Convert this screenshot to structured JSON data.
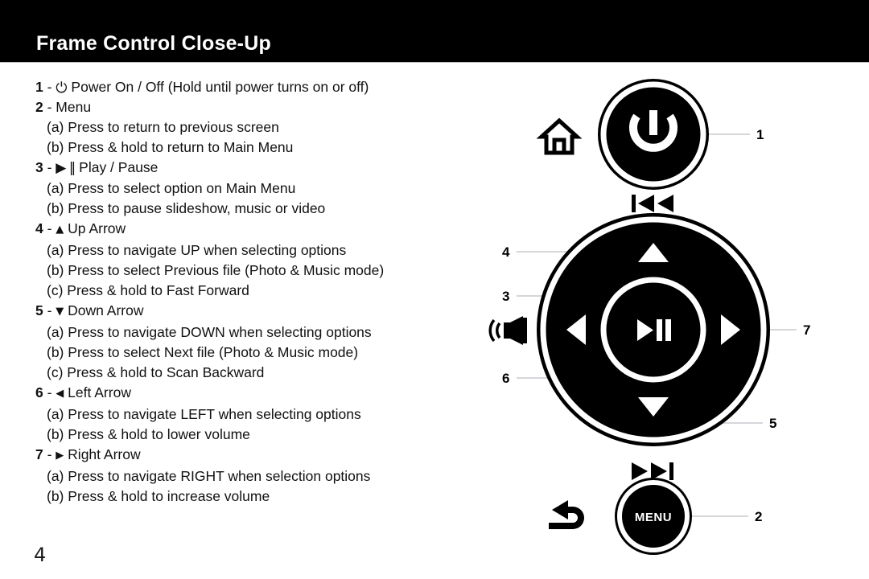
{
  "header": {
    "title": "Frame Control Close-Up"
  },
  "page_number": "4",
  "instructions": [
    {
      "type": "item",
      "num": "1",
      "dash": "-",
      "icon": "power-icon",
      "glyph": "⏻",
      "text": "Power On / Off (Hold until power turns on or off)"
    },
    {
      "type": "item",
      "num": "2",
      "dash": "-",
      "icon": "",
      "glyph": "",
      "text": "Menu"
    },
    {
      "type": "sub",
      "label": "(a)",
      "text": "Press to return to previous screen"
    },
    {
      "type": "sub",
      "label": "(b)",
      "text": "Press & hold to return to Main Menu"
    },
    {
      "type": "item",
      "num": "3",
      "dash": "-",
      "icon": "play-pause-icon",
      "glyph": "▶ ‖",
      "text": "Play / Pause"
    },
    {
      "type": "sub",
      "label": "(a)",
      "text": "Press to select option on Main Menu"
    },
    {
      "type": "sub",
      "label": "(b)",
      "text": "Press to pause slideshow, music or video"
    },
    {
      "type": "item",
      "num": "4",
      "dash": "-",
      "icon": "up-arrow-icon",
      "glyph": "▲",
      "text": "Up Arrow"
    },
    {
      "type": "sub",
      "label": "(a)",
      "text": "Press to navigate UP when selecting options"
    },
    {
      "type": "sub",
      "label": "(b)",
      "text": "Press to select Previous file (Photo & Music mode)"
    },
    {
      "type": "sub",
      "label": "(c)",
      "text": "Press & hold to Fast Forward"
    },
    {
      "type": "item",
      "num": "5",
      "dash": "-",
      "icon": "down-arrow-icon",
      "glyph": "▼",
      "text": "Down Arrow"
    },
    {
      "type": "sub",
      "label": "(a)",
      "text": "Press to navigate DOWN when selecting options"
    },
    {
      "type": "sub",
      "label": "(b)",
      "text": "Press to select Next file (Photo & Music mode)"
    },
    {
      "type": "sub",
      "label": "(c)",
      "text": "Press & hold to Scan Backward"
    },
    {
      "type": "item",
      "num": "6",
      "dash": "-",
      "icon": "left-arrow-icon",
      "glyph": "◀",
      "text": "Left Arrow"
    },
    {
      "type": "sub",
      "label": "(a)",
      "text": "Press to navigate LEFT when selecting options"
    },
    {
      "type": "sub",
      "label": "(b)",
      "text": "Press & hold to lower volume"
    },
    {
      "type": "item",
      "num": "7",
      "dash": "-",
      "icon": "right-arrow-icon",
      "glyph": "▶",
      "text": "Right Arrow"
    },
    {
      "type": "sub",
      "label": "(a)",
      "text": "Press to navigate RIGHT when selection options"
    },
    {
      "type": "sub",
      "label": "(b)",
      "text": "Press & hold to increase volume"
    }
  ],
  "diagram": {
    "menu_button_label": "MENU",
    "callouts": [
      {
        "id": "1",
        "label": "1",
        "target": "power-button"
      },
      {
        "id": "2",
        "label": "2",
        "target": "menu-button"
      },
      {
        "id": "3",
        "label": "3",
        "target": "play-pause-button"
      },
      {
        "id": "4",
        "label": "4",
        "target": "up-arrow-button"
      },
      {
        "id": "5",
        "label": "5",
        "target": "down-arrow-button"
      },
      {
        "id": "6",
        "label": "6",
        "target": "left-arrow-button"
      },
      {
        "id": "7",
        "label": "7",
        "target": "right-arrow-button"
      }
    ],
    "side_icons": [
      {
        "name": "home-icon"
      },
      {
        "name": "previous-track-icon"
      },
      {
        "name": "volume-speaker-icon"
      },
      {
        "name": "next-track-icon"
      },
      {
        "name": "back-arrow-icon"
      }
    ]
  },
  "colors": {
    "header_bg": "#000000",
    "header_text": "#ffffff",
    "body_bg": "#ffffff",
    "button_fill": "#000000",
    "button_ring": "#ffffff",
    "callout_line": "#c9c9cf",
    "text": "#111111"
  }
}
